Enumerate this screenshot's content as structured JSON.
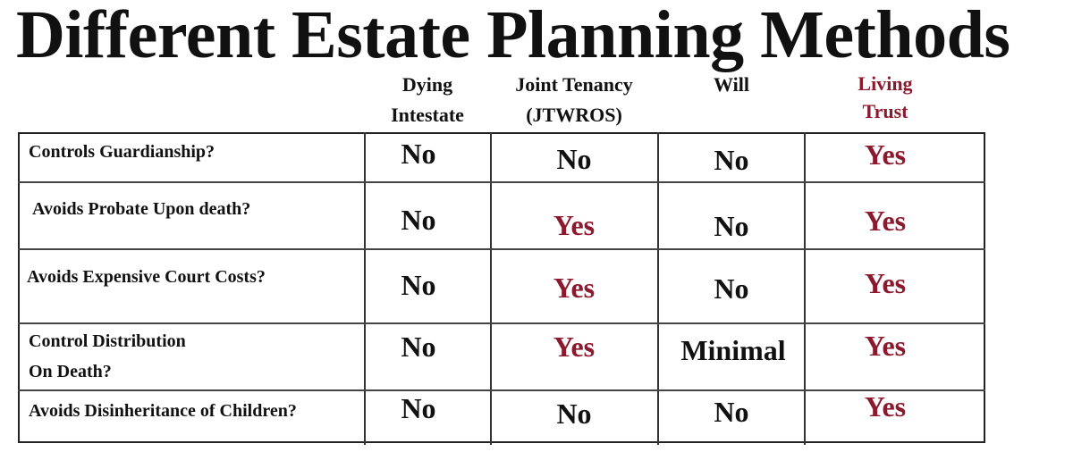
{
  "title": "Different Estate Planning Methods",
  "columns": [
    {
      "line1": "Dying",
      "line2": "Intestate"
    },
    {
      "line1": "Joint Tenancy",
      "line2": "(JTWROS)"
    },
    {
      "line1": "Will",
      "line2": ""
    },
    {
      "line1": "Living",
      "line2": "Trust"
    }
  ],
  "rows": [
    {
      "label1": "Controls Guardianship?",
      "label2": "",
      "cells": [
        "No",
        "No",
        "No",
        "Yes"
      ]
    },
    {
      "label1": "Avoids Probate Upon death?",
      "label2": "",
      "cells": [
        "No",
        "Yes",
        "No",
        "Yes"
      ]
    },
    {
      "label1": "Avoids Expensive Court Costs?",
      "label2": "",
      "cells": [
        "No",
        "Yes",
        "No",
        "Yes"
      ]
    },
    {
      "label1": "Control Distribution",
      "label2": "On Death?",
      "cells": [
        "No",
        "Yes",
        "Minimal",
        "Yes"
      ]
    },
    {
      "label1": "Avoids Disinheritance of Children?",
      "label2": "",
      "cells": [
        "No",
        "No",
        "No",
        "Yes"
      ]
    }
  ],
  "colors": {
    "highlight": "#8b1a2e",
    "text": "#111111"
  }
}
